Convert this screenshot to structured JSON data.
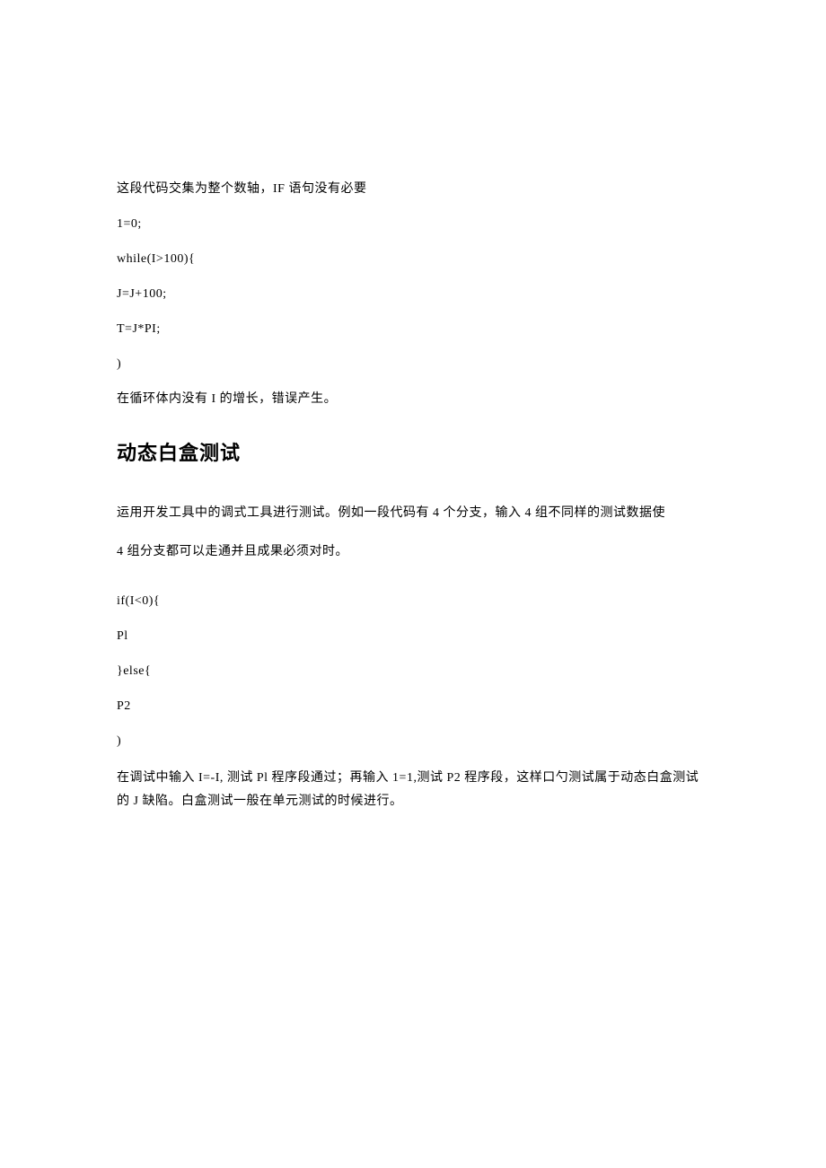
{
  "l1": "这段代码交集为整个数轴，IF 语句没有必要",
  "l2": "1=0;",
  "l3": "while(I>100){",
  "l4": "J=J+100;",
  "l5": "T=J*PI;",
  "l6": ")",
  "l7": "在循环体内没有 I 的增长，错误产生。",
  "h1": "动态白盒测试",
  "p1": "运用开发工具中的调式工具进行测试。例如一段代码有 4 个分支，输入 4 组不同样的测试数据使",
  "p2": "4 组分支都可以走通并且成果必须对时。",
  "l8": "if(I<0){",
  "l9": "Pl",
  "l10": "}else{",
  "l11": "P2",
  "l12": ")",
  "p3": "在调试中输入 I=-I, 测试 Pl 程序段通过；再输入 1=1,测试 P2 程序段，这样口勺测试属于动态白盒测试的 J 缺陷。白盒测试一般在单元测试的时候进行。"
}
